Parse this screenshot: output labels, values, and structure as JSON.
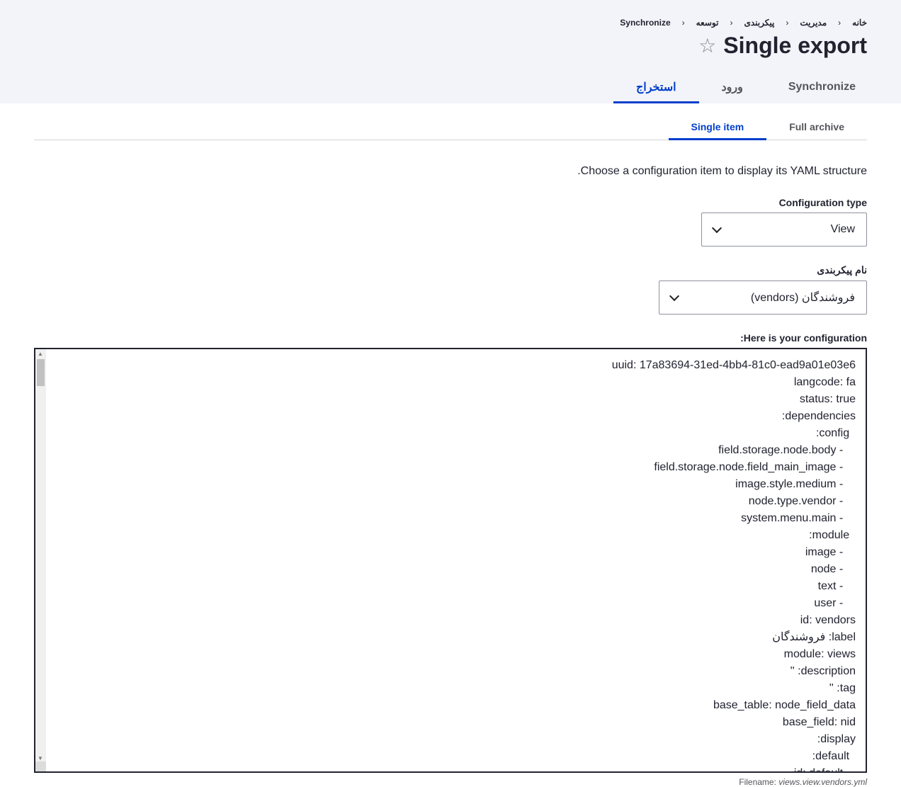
{
  "breadcrumb": [
    "خانه",
    "مدیریت",
    "پیکربندی",
    "توسعه",
    "Synchronize"
  ],
  "page_title": "Single export",
  "primary_tabs": [
    {
      "label": "Synchronize",
      "active": false
    },
    {
      "label": "ورود",
      "active": false
    },
    {
      "label": "استخراج",
      "active": true
    }
  ],
  "secondary_tabs": [
    {
      "label": "Full archive",
      "active": false
    },
    {
      "label": "Single item",
      "active": true
    }
  ],
  "description": "Choose a configuration item to display its YAML structure.",
  "config_type": {
    "label": "Configuration type",
    "value": "View"
  },
  "config_name": {
    "label": "نام پیکربندی",
    "value": "فروشندگان (vendors)"
  },
  "output": {
    "label": "Here is your configuration:",
    "lines": [
      "uuid: 17a83694-31ed-4bb4-81c0-ead9a01e03e6",
      "langcode: fa",
      "status: true",
      "dependencies:",
      "  config:",
      "    - field.storage.node.body",
      "    - field.storage.node.field_main_image",
      "    - image.style.medium",
      "    - node.type.vendor",
      "    - system.menu.main",
      "  module:",
      "    - image",
      "    - node",
      "    - text",
      "    - user",
      "id: vendors",
      "label: فروشندگان",
      "module: views",
      "description: ''",
      "tag: ''",
      "base_table: node_field_data",
      "base_field: nid",
      "display:",
      "  default:",
      "    id: default"
    ]
  },
  "filename": {
    "label": "Filename:",
    "value": "views.view.vendors.yml"
  },
  "colors": {
    "accent": "#003ecc",
    "header_bg": "#f3f4f9"
  }
}
